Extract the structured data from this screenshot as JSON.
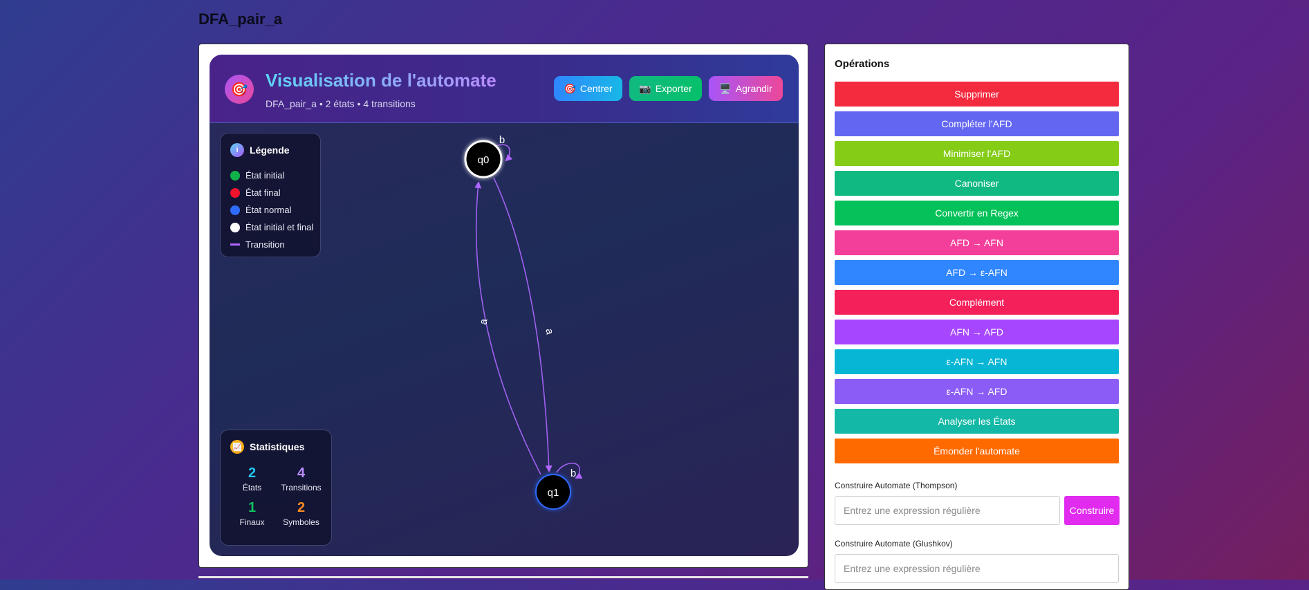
{
  "page": {
    "title": "DFA_pair_a"
  },
  "viz": {
    "icon": "🎯",
    "title": "Visualisation de l'automate",
    "subtitle": "DFA_pair_a • 2 états • 4 transitions",
    "buttons": [
      {
        "icon": "🎯",
        "label": "Centrer"
      },
      {
        "icon": "📷",
        "label": "Exporter"
      },
      {
        "icon": "🖥️",
        "label": "Agrandir"
      }
    ]
  },
  "legend": {
    "icon": "i",
    "title": "Légende",
    "items": [
      {
        "label": "État initial",
        "color": "#10b34a"
      },
      {
        "label": "État final",
        "color": "#f0132e"
      },
      {
        "label": "État normal",
        "color": "#2f6bff"
      },
      {
        "label": "État initial et final",
        "color": "#ffffff"
      },
      {
        "label": "Transition",
        "color": "#b066ff"
      }
    ]
  },
  "graph": {
    "states": [
      {
        "name": "q0"
      },
      {
        "name": "q1"
      }
    ],
    "transitions": [
      {
        "from": "q0",
        "to": "q0",
        "label": "b"
      },
      {
        "from": "q0",
        "to": "q1",
        "label": "a"
      },
      {
        "from": "q1",
        "to": "q0",
        "label": "a"
      },
      {
        "from": "q1",
        "to": "q1",
        "label": "b"
      }
    ]
  },
  "stats": {
    "icon": "📈",
    "title": "Statistiques",
    "items": [
      {
        "value": "2",
        "label": "États",
        "color": "#22c7f0"
      },
      {
        "value": "4",
        "label": "Transitions",
        "color": "#b98cff"
      },
      {
        "value": "1",
        "label": "Finaux",
        "color": "#10c060"
      },
      {
        "value": "2",
        "label": "Symboles",
        "color": "#ff8a1f"
      }
    ]
  },
  "operations": {
    "title": "Opérations",
    "buttons": [
      {
        "label": "Supprimer",
        "color": "#f42a3e"
      },
      {
        "label": "Compléter l'AFD",
        "color": "#6366f1"
      },
      {
        "label": "Minimiser l'AFD",
        "color": "#84cc16"
      },
      {
        "label": "Canoniser",
        "color": "#10b981"
      },
      {
        "label": "Convertir en Regex",
        "color": "#04c259"
      },
      {
        "label": "AFD → AFN",
        "color": "#f43f9a"
      },
      {
        "label": "AFD → ε-AFN",
        "color": "#2f86ff"
      },
      {
        "label": "Complément",
        "color": "#f4205a"
      },
      {
        "label": "AFN → AFD",
        "color": "#a647ff"
      },
      {
        "label": "ε-AFN → AFN",
        "color": "#06b6d4"
      },
      {
        "label": "ε-AFN → AFD",
        "color": "#8b5cf6"
      },
      {
        "label": "Analyser les États",
        "color": "#14b8a6"
      },
      {
        "label": "Émonder l'automate",
        "color": "#ff6a00"
      }
    ],
    "thompson": {
      "label": "Construire Automate (Thompson)",
      "placeholder": "Entrez une expression régulière",
      "button": "Construire"
    },
    "glushkov": {
      "label": "Construire Automate (Glushkov)",
      "placeholder": "Entrez une expression régulière"
    }
  }
}
